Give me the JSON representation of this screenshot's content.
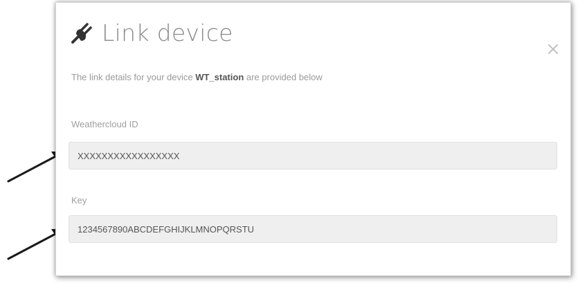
{
  "dialog": {
    "title": "Link device",
    "close_label": "×",
    "intro": {
      "before": "The link details for your device ",
      "device_name": "WT_station",
      "after": " are provided below"
    }
  },
  "fields": {
    "weathercloud_id": {
      "label": "Weathercloud ID",
      "value": "XXXXXXXXXXXXXXXXX"
    },
    "key": {
      "label": "Key",
      "value": "1234567890ABCDEFGHIJKLMNOPQRSTU"
    }
  },
  "icons": {
    "title_icon": "plug-icon",
    "close_icon": "close-icon",
    "pointer_arrows": "arrow-icon"
  },
  "colors": {
    "title": "#8a8a8a",
    "text_muted": "#9a9a9a",
    "field_bg": "#efefef",
    "arrow": "#1a1a1a"
  }
}
